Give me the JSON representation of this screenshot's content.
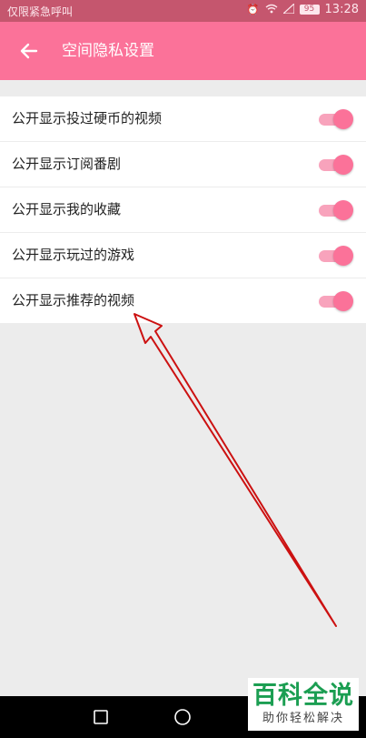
{
  "status_bar": {
    "carrier": "仅限紧急呼叫",
    "battery": "95",
    "time": "13:28"
  },
  "header": {
    "title": "空间隐私设置"
  },
  "settings": [
    {
      "label": "公开显示投过硬币的视频",
      "enabled": true
    },
    {
      "label": "公开显示订阅番剧",
      "enabled": true
    },
    {
      "label": "公开显示我的收藏",
      "enabled": true
    },
    {
      "label": "公开显示玩过的游戏",
      "enabled": true
    },
    {
      "label": "公开显示推荐的视频",
      "enabled": true
    }
  ],
  "watermark": {
    "main": "百科全说",
    "sub": "助你轻松解决"
  },
  "colors": {
    "accent": "#fb7299",
    "toggle_track": "#f8a3bc",
    "status_bar": "#c5566e",
    "annotation_arrow": "#cc1111"
  },
  "icons": {
    "back": "arrow-left-icon",
    "wifi": "wifi-icon",
    "signal": "signal-icon",
    "recents": "square-recents-icon",
    "home": "circle-home-icon"
  }
}
